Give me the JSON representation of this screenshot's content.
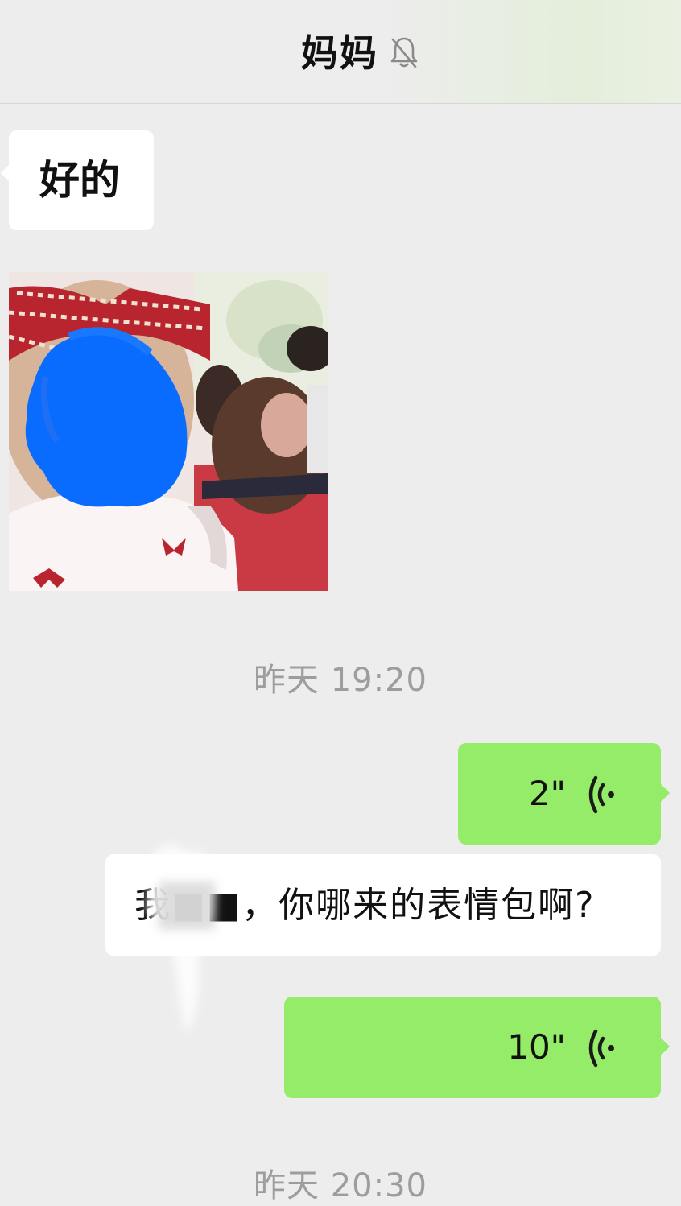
{
  "header": {
    "title": "妈妈",
    "icon": "bell-slash-icon"
  },
  "messages": {
    "incoming_text_1": "好的",
    "incoming_image": {
      "icon": "photo"
    },
    "timestamp_1": "昨天 19:20",
    "outgoing_voice_1": {
      "duration": "2\"",
      "icon": "voice-wave-icon"
    },
    "incoming_text_2": "我■■，你哪来的表情包啊?",
    "outgoing_voice_2": {
      "duration": "10\"",
      "icon": "voice-wave-icon"
    },
    "timestamp_2": "昨天 20:30"
  },
  "colors": {
    "background": "#ededed",
    "incoming_bubble": "#ffffff",
    "outgoing_bubble": "#95ec69",
    "timestamp_text": "#9d9d9d"
  }
}
